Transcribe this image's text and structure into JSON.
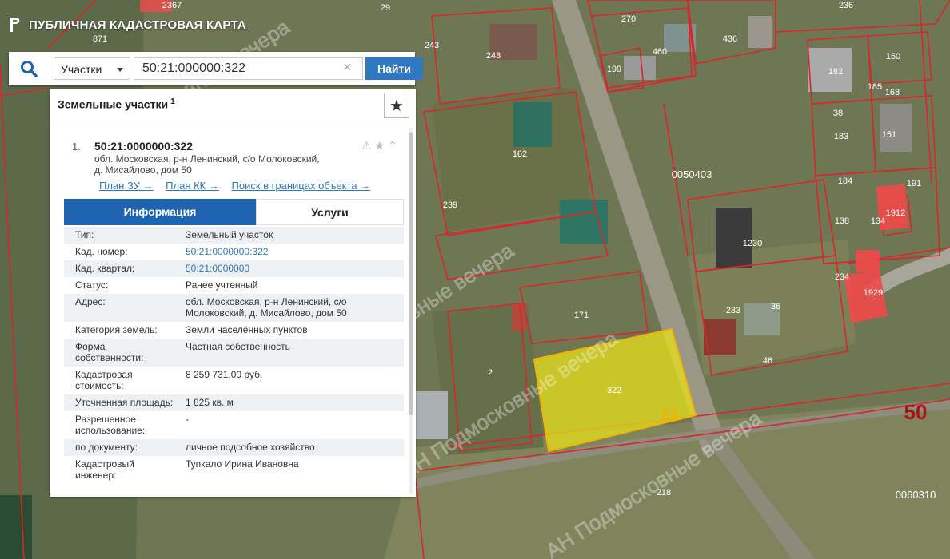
{
  "header": {
    "title": "ПУБЛИЧНАЯ КАДАСТРОВАЯ КАРТА"
  },
  "search": {
    "type_label": "Участки",
    "value": "50:21:000000:322",
    "find_label": "Найти"
  },
  "panel": {
    "title": "Земельные участки",
    "count": "1",
    "item": {
      "number": "1.",
      "cad_number": "50:21:0000000:322",
      "address_line1": "обл. Московская, р-н Ленинский, с/о Молоковский,",
      "address_line2": "д. Мисайлово, дом 50"
    },
    "links": {
      "plan_zu": "План ЗУ →",
      "plan_kk": "План КК →",
      "search_bounds": "Поиск в границах объекта →"
    },
    "tabs": {
      "info": "Информация",
      "services": "Услуги"
    },
    "rows": [
      {
        "k": "Тип:",
        "v": "Земельный участок"
      },
      {
        "k": "Кад. номер:",
        "v": "50:21:0000000:322"
      },
      {
        "k": "Кад. квартал:",
        "v": "50:21:0000000"
      },
      {
        "k": "Статус:",
        "v": "Ранее учтенный"
      },
      {
        "k": "Адрес:",
        "v": "обл. Московская, р-н Ленинский, с/о Молоковский, д. Мисайлово, дом 50"
      },
      {
        "k": "Категория земель:",
        "v": "Земли населённых пунктов"
      },
      {
        "k": "Форма собственности:",
        "v": "Частная собственность"
      },
      {
        "k": "Кадастровая стоимость:",
        "v": "8 259 731,00 руб."
      },
      {
        "k": "Уточненная площадь:",
        "v": "1 825 кв. м"
      },
      {
        "k": "Разрешенное использование:",
        "v": "-"
      },
      {
        "k": "по документу:",
        "v": "личное подсобное хозяйство"
      },
      {
        "k": "Кадастровый инженер:",
        "v": "Тупкало Ирина Ивановна"
      }
    ]
  },
  "map": {
    "labels": [
      "871",
      "29",
      "236",
      "270",
      "243",
      "436",
      "460",
      "199",
      "150",
      "182",
      "185",
      "168",
      "38",
      "183",
      "151",
      "162",
      "0050403",
      "184",
      "191",
      "239",
      "138",
      "134",
      "1230",
      "234",
      "233",
      "36",
      "171",
      "2",
      "322",
      "21",
      "50",
      "218",
      "0060310",
      "1912",
      "1929",
      "46",
      "2367",
      "243"
    ],
    "watermark": "АН Подмосковные вечера"
  }
}
